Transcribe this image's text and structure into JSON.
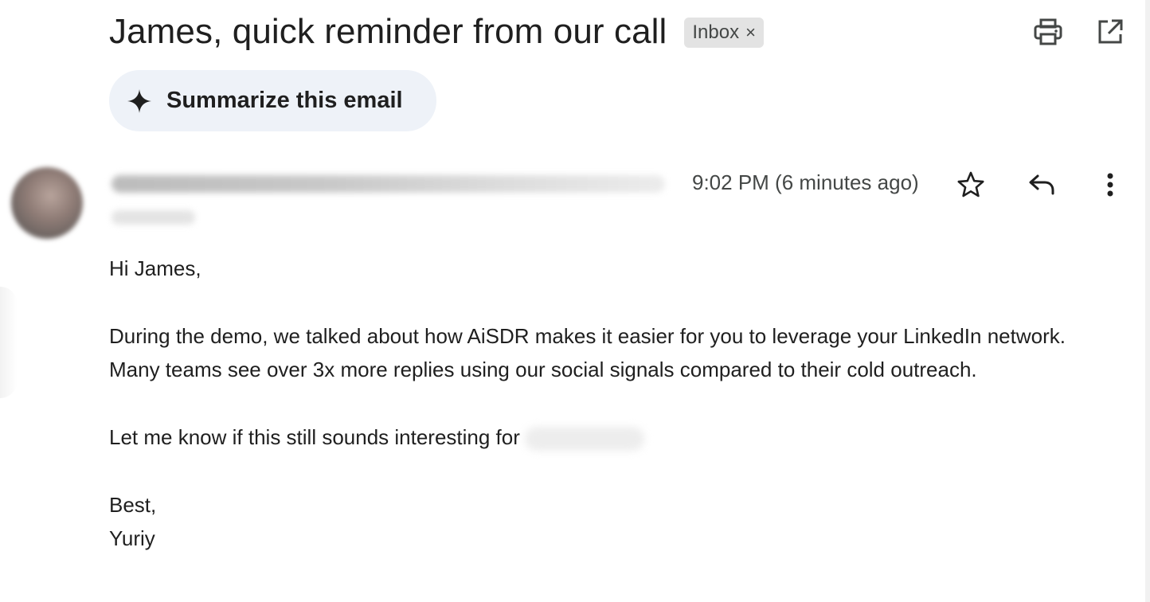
{
  "header": {
    "subject": "James, quick reminder from our call",
    "label_chip": "Inbox",
    "label_chip_remove": "×",
    "icons": [
      "print-icon",
      "open-in-new-window-icon"
    ]
  },
  "summarize": {
    "label": "Summarize this email",
    "icon": "sparkle-icon"
  },
  "message": {
    "timestamp": "9:02 PM (6 minutes ago)",
    "actions": [
      "star-icon",
      "reply-icon",
      "more-vert-icon"
    ],
    "body": {
      "greeting": "Hi James,",
      "paragraph1": "During the demo, we talked about how AiSDR makes it easier for you to leverage your LinkedIn network. Many teams see over 3x more replies using our social signals compared to their cold outreach.",
      "paragraph2": "Let me know if this still sounds interesting for",
      "signoff": "Best,",
      "signature": "Yuriy"
    }
  },
  "colors": {
    "text_primary": "#1f1f1f",
    "text_secondary": "#444746",
    "chip_bg": "#e3e3e3",
    "summarize_bg": "#eef2f8"
  }
}
